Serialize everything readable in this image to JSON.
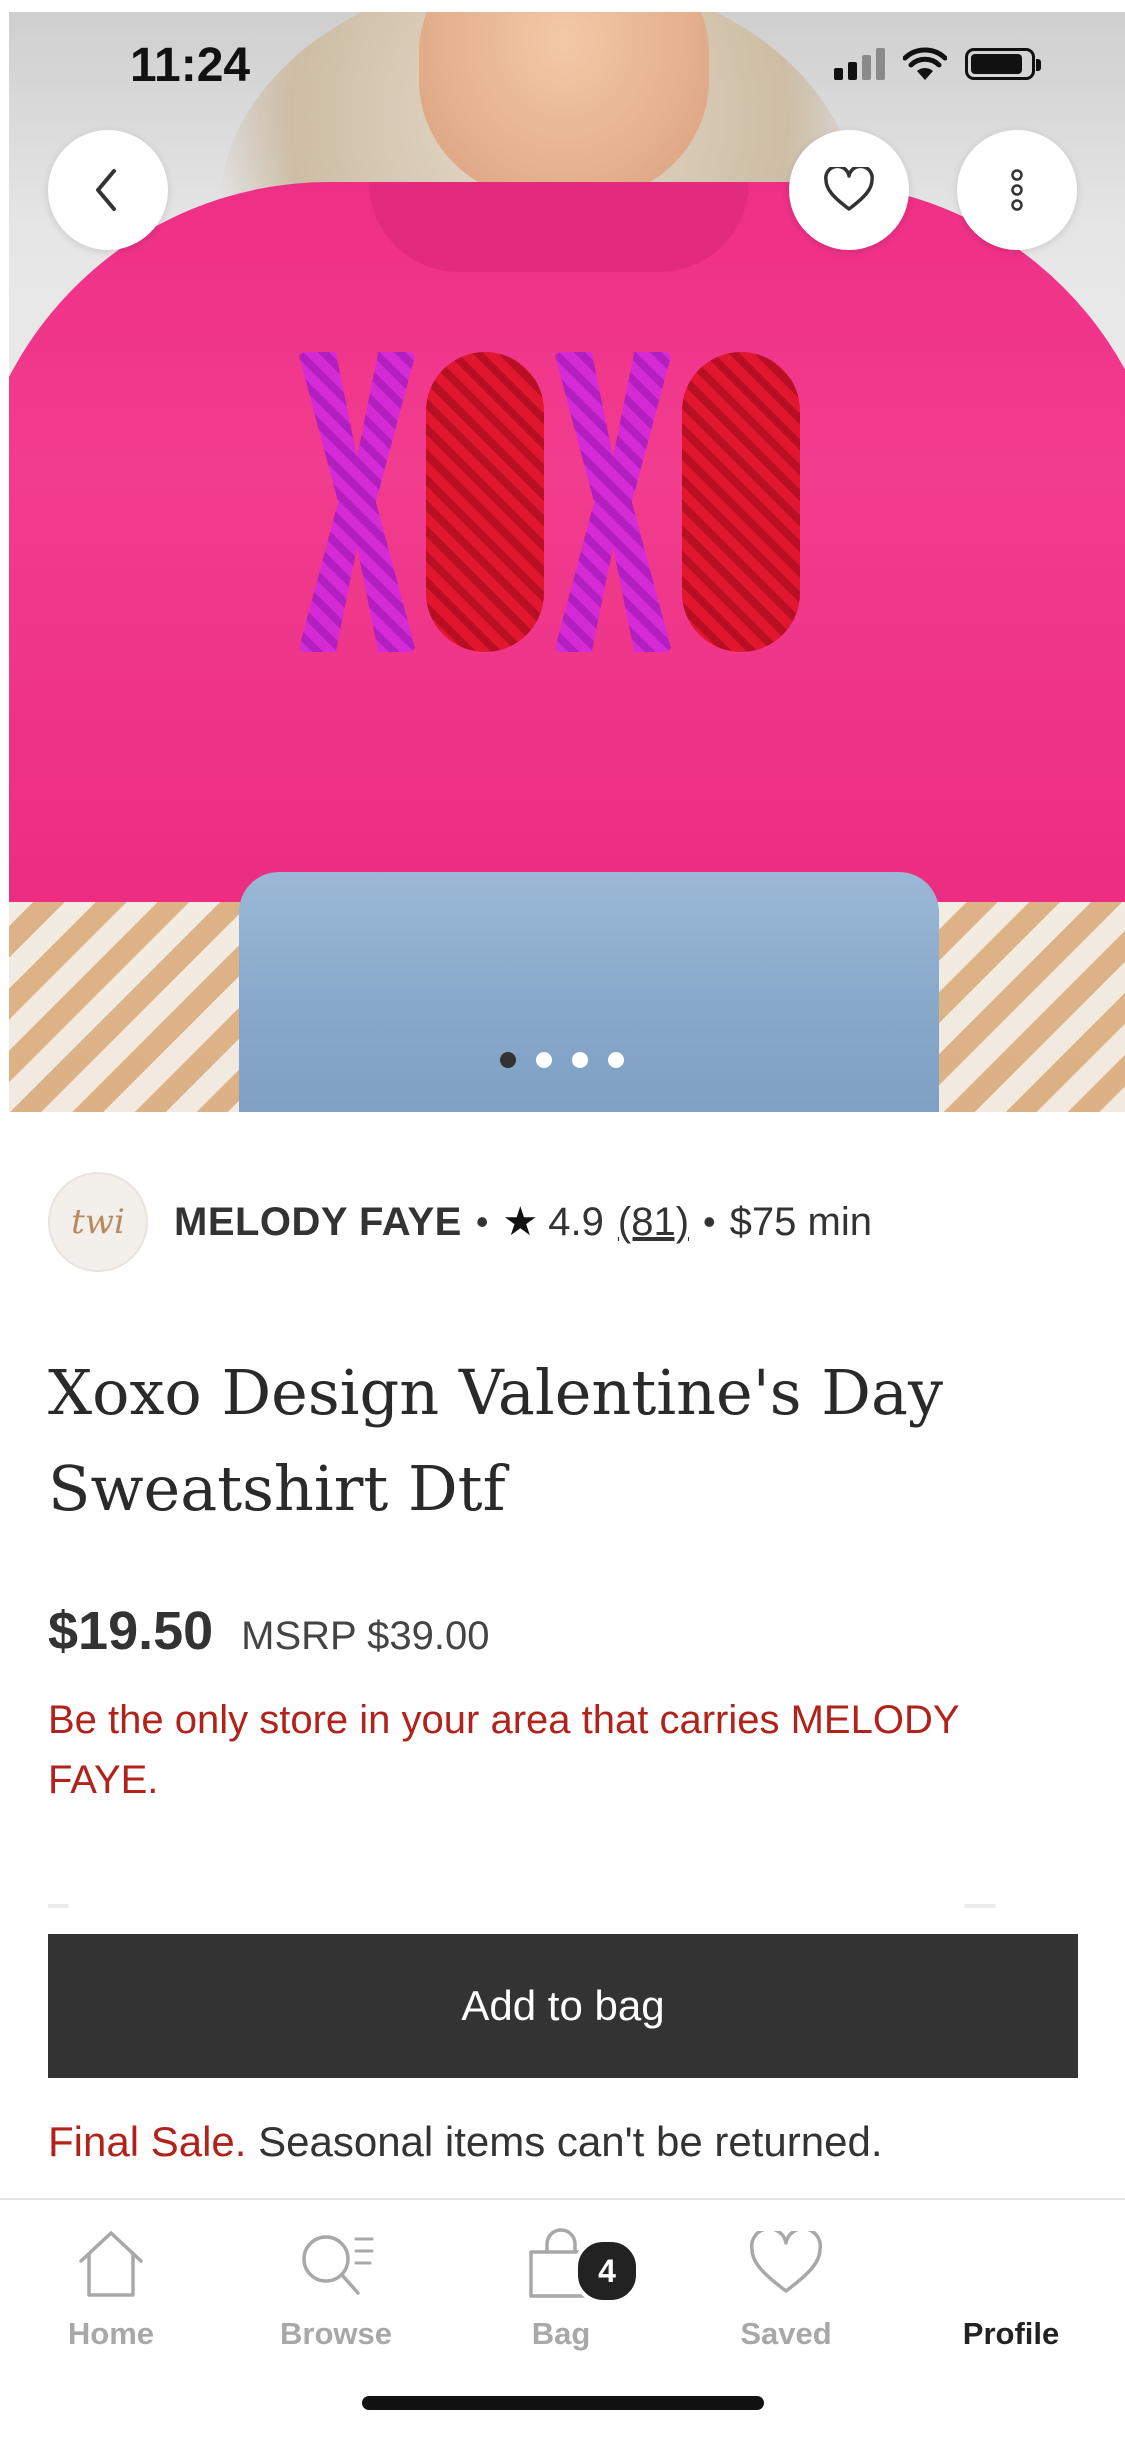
{
  "status": {
    "time": "11:24"
  },
  "hero": {
    "image_alt": "Pink XOXO sequin sweatshirt",
    "slide_count": 4,
    "active_slide": 1
  },
  "seller": {
    "name": "MELODY FAYE",
    "rating": "4.9",
    "review_count": "(81)",
    "minimum": "$75 min",
    "separator": "•",
    "avatar_text": "twi"
  },
  "product": {
    "title": "Xoxo Design Valentine's Day Sweatshirt Dtf",
    "price": "$19.50",
    "msrp": "MSRP $39.00",
    "promo": "Be the only store in your area that carries MELODY FAYE."
  },
  "actions": {
    "add_to_bag": "Add to bag"
  },
  "return_policy": {
    "label": "Final Sale.",
    "text": "Seasonal items can't be returned."
  },
  "tabs": [
    {
      "label": "Home",
      "icon": "home-icon"
    },
    {
      "label": "Browse",
      "icon": "search-list-icon"
    },
    {
      "label": "Bag",
      "icon": "bag-icon",
      "badge": "4"
    },
    {
      "label": "Saved",
      "icon": "heart-icon"
    },
    {
      "label": "Profile",
      "icon": "profile-icon",
      "active": true
    }
  ],
  "colors": {
    "accent_red": "#b1221b",
    "button_dark": "#333333",
    "sweater_pink": "#ee2f86"
  }
}
